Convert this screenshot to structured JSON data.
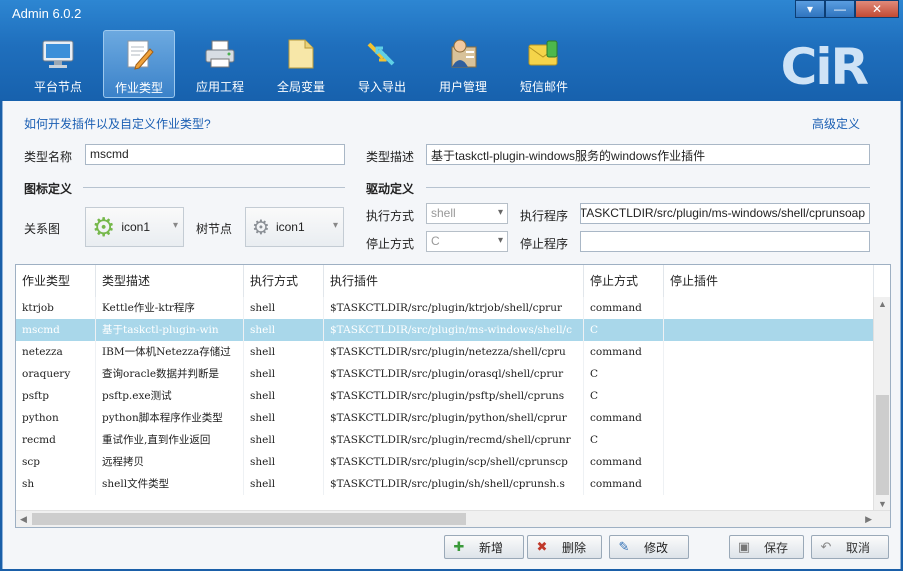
{
  "window": {
    "title": "Admin 6.0.2",
    "controls": [
      "▾",
      "—",
      "✕"
    ]
  },
  "toolbar": [
    {
      "label": "平台节点",
      "icon": "monitor-icon",
      "active": false
    },
    {
      "label": "作业类型",
      "icon": "edit-document-icon",
      "active": true
    },
    {
      "label": "应用工程",
      "icon": "printer-icon",
      "active": false
    },
    {
      "label": "全局变量",
      "icon": "folder-document-icon",
      "active": false
    },
    {
      "label": "导入导出",
      "icon": "import-export-arrows-icon",
      "active": false
    },
    {
      "label": "用户管理",
      "icon": "user-management-icon",
      "active": false
    },
    {
      "label": "短信邮件",
      "icon": "sms-mail-icon",
      "active": false
    }
  ],
  "logo": "CiR",
  "help_link": "如何开发插件以及自定义作业类型?",
  "advanced_link": "高级定义",
  "form": {
    "type_name_label": "类型名称",
    "type_name_value": "mscmd",
    "type_desc_label": "类型描述",
    "type_desc_value": "基于taskctl-plugin-windows服务的windows作业插件",
    "icon_section": "图标定义",
    "driver_section": "驱动定义",
    "relation_label": "关系图",
    "relation_icon": "icon1",
    "tree_label": "树节点",
    "tree_icon": "icon1",
    "exec_mode_label": "执行方式",
    "exec_mode_value": "shell",
    "exec_prog_label": "执行程序",
    "exec_prog_value": "$TASKCTLDIR/src/plugin/ms-windows/shell/cprunsoap",
    "stop_mode_label": "停止方式",
    "stop_mode_value": "C",
    "stop_prog_label": "停止程序",
    "stop_prog_value": ""
  },
  "table": {
    "columns": [
      "作业类型",
      "类型描述",
      "执行方式",
      "执行插件",
      "停止方式",
      "停止插件"
    ],
    "rows": [
      [
        "ktrjob",
        "Kettle作业-ktr程序",
        "shell",
        "$TASKCTLDIR/src/plugin/ktrjob/shell/cprur",
        "command",
        ""
      ],
      [
        "mscmd",
        "基于taskctl-plugin-win",
        "shell",
        "$TASKCTLDIR/src/plugin/ms-windows/shell/c",
        "C",
        ""
      ],
      [
        "netezza",
        "IBM一体机Netezza存储过",
        "shell",
        "$TASKCTLDIR/src/plugin/netezza/shell/cpru",
        "command",
        ""
      ],
      [
        "oraquery",
        "查询oracle数据并判断是",
        "shell",
        "$TASKCTLDIR/src/plugin/orasql/shell/cprur",
        "C",
        ""
      ],
      [
        "psftp",
        "psftp.exe测试",
        "shell",
        "$TASKCTLDIR/src/plugin/psftp/shell/cpruns",
        "C",
        ""
      ],
      [
        "python",
        "python脚本程序作业类型",
        "shell",
        "$TASKCTLDIR/src/plugin/python/shell/cprur",
        "command",
        ""
      ],
      [
        "recmd",
        "重试作业,直到作业返回",
        "shell",
        "$TASKCTLDIR/src/plugin/recmd/shell/cprunr",
        "C",
        ""
      ],
      [
        "scp",
        "远程拷贝",
        "shell",
        "$TASKCTLDIR/src/plugin/scp/shell/cprunscp",
        "command",
        ""
      ],
      [
        "sh",
        "shell文件类型",
        "shell",
        "$TASKCTLDIR/src/plugin/sh/shell/cprunsh.s",
        "command",
        ""
      ]
    ],
    "selected_row": 1
  },
  "buttons": {
    "add": "新增",
    "delete": "删除",
    "modify": "修改",
    "save": "保存",
    "cancel": "取消"
  }
}
